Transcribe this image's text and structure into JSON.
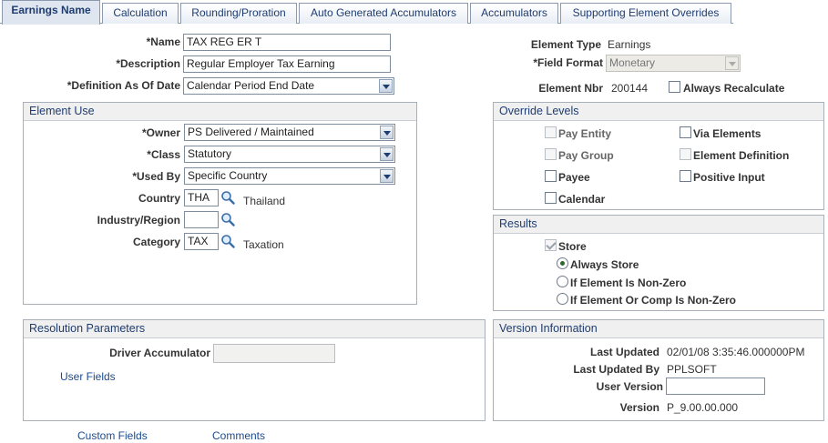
{
  "tabs": [
    {
      "label": "Earnings Name",
      "active": true
    },
    {
      "label": "Calculation"
    },
    {
      "label": "Rounding/Proration"
    },
    {
      "label": "Auto Generated Accumulators"
    },
    {
      "label": "Accumulators"
    },
    {
      "label": "Supporting Element Overrides"
    }
  ],
  "form": {
    "name_label": "*Name",
    "name_value": "TAX REG ER T",
    "description_label": "*Description",
    "description_value": "Regular Employer Tax Earning",
    "def_date_label": "*Definition As Of Date",
    "def_date_value": "Calendar Period End Date",
    "element_type_label": "Element Type",
    "element_type_value": "Earnings",
    "field_format_label": "*Field Format",
    "field_format_value": "Monetary",
    "element_nbr_label": "Element Nbr",
    "element_nbr_value": "200144",
    "always_recalc_label": "Always Recalculate"
  },
  "element_use": {
    "title": "Element Use",
    "owner_label": "*Owner",
    "owner_value": "PS Delivered / Maintained",
    "class_label": "*Class",
    "class_value": "Statutory",
    "used_by_label": "*Used By",
    "used_by_value": "Specific Country",
    "country_label": "Country",
    "country_value": "THA",
    "country_desc": "Thailand",
    "industry_label": "Industry/Region",
    "industry_value": "",
    "category_label": "Category",
    "category_value": "TAX",
    "category_desc": "Taxation"
  },
  "override_levels": {
    "title": "Override Levels",
    "items": {
      "pay_entity": "Pay Entity",
      "via_elements": "Via Elements",
      "pay_group": "Pay Group",
      "element_definition": "Element Definition",
      "payee": "Payee",
      "positive_input": "Positive Input",
      "calendar": "Calendar"
    }
  },
  "results": {
    "title": "Results",
    "store_label": "Store",
    "store_checked": true,
    "options": [
      "Always Store",
      "If Element Is Non-Zero",
      "If Element Or Comp Is Non-Zero"
    ],
    "selected": "Always Store"
  },
  "resolution": {
    "title": "Resolution Parameters",
    "driver_label": "Driver Accumulator",
    "driver_value": "",
    "user_fields_link": "User Fields"
  },
  "version": {
    "title": "Version Information",
    "last_updated_label": "Last Updated",
    "last_updated_value": "02/01/08  3:35:46.000000PM",
    "last_updated_by_label": "Last Updated By",
    "last_updated_by_value": "PPLSOFT",
    "user_version_label": "User Version",
    "user_version_value": "",
    "version_label": "Version",
    "version_value": "P_9.00.00.000"
  },
  "footer": {
    "custom_fields": "Custom Fields",
    "comments": "Comments"
  },
  "icons": {
    "lookup": "magnifier-lookup-icon",
    "dropdown": "chevron-down-icon"
  },
  "colors": {
    "link": "#1a4a8e",
    "tab_text": "#1f3c70",
    "group_header_bg": "#f0f0f0",
    "border": "#a8b0ba"
  }
}
